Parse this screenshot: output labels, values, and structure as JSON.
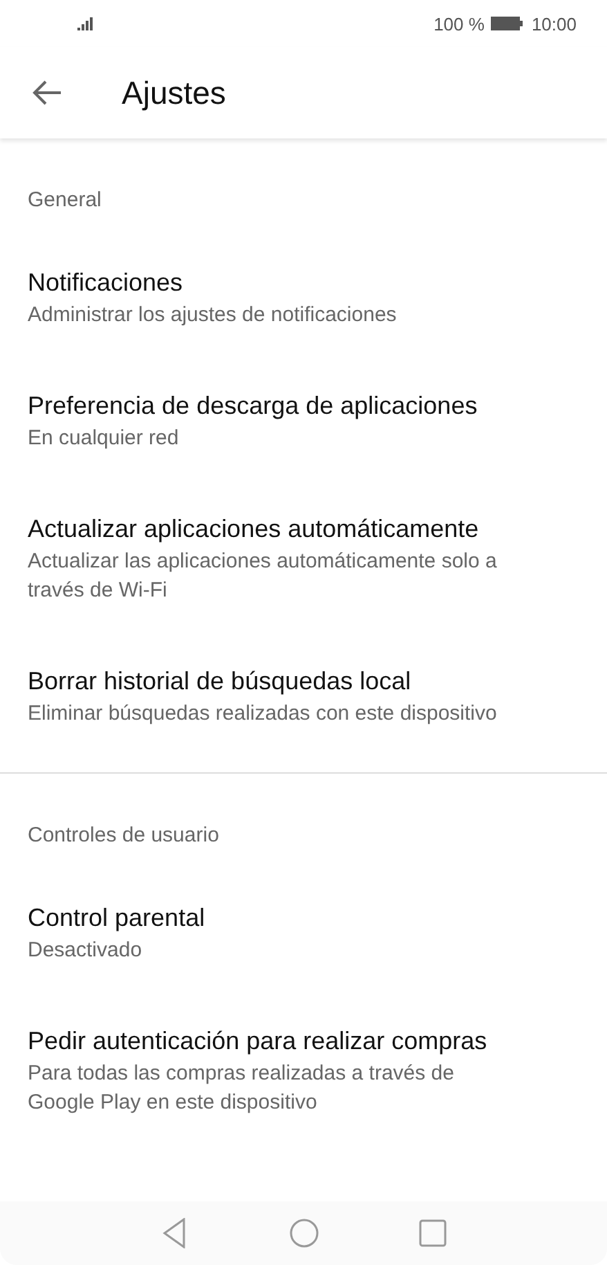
{
  "status_bar": {
    "battery": "100 %",
    "time": "10:00"
  },
  "header": {
    "title": "Ajustes"
  },
  "sections": [
    {
      "title": "General",
      "items": [
        {
          "title": "Notificaciones",
          "subtitle": "Administrar los ajustes de notificaciones"
        },
        {
          "title": "Preferencia de descarga de aplicaciones",
          "subtitle": "En cualquier red"
        },
        {
          "title": "Actualizar aplicaciones automáticamente",
          "subtitle": "Actualizar las aplicaciones automáticamente solo a través de Wi-Fi"
        },
        {
          "title": "Borrar historial de búsquedas local",
          "subtitle": "Eliminar búsquedas realizadas con este dispositivo"
        }
      ]
    },
    {
      "title": "Controles de usuario",
      "items": [
        {
          "title": "Control parental",
          "subtitle": "Desactivado"
        },
        {
          "title": "Pedir autenticación para realizar compras",
          "subtitle": "Para todas las compras realizadas a través de Google Play en este dispositivo"
        }
      ]
    }
  ]
}
